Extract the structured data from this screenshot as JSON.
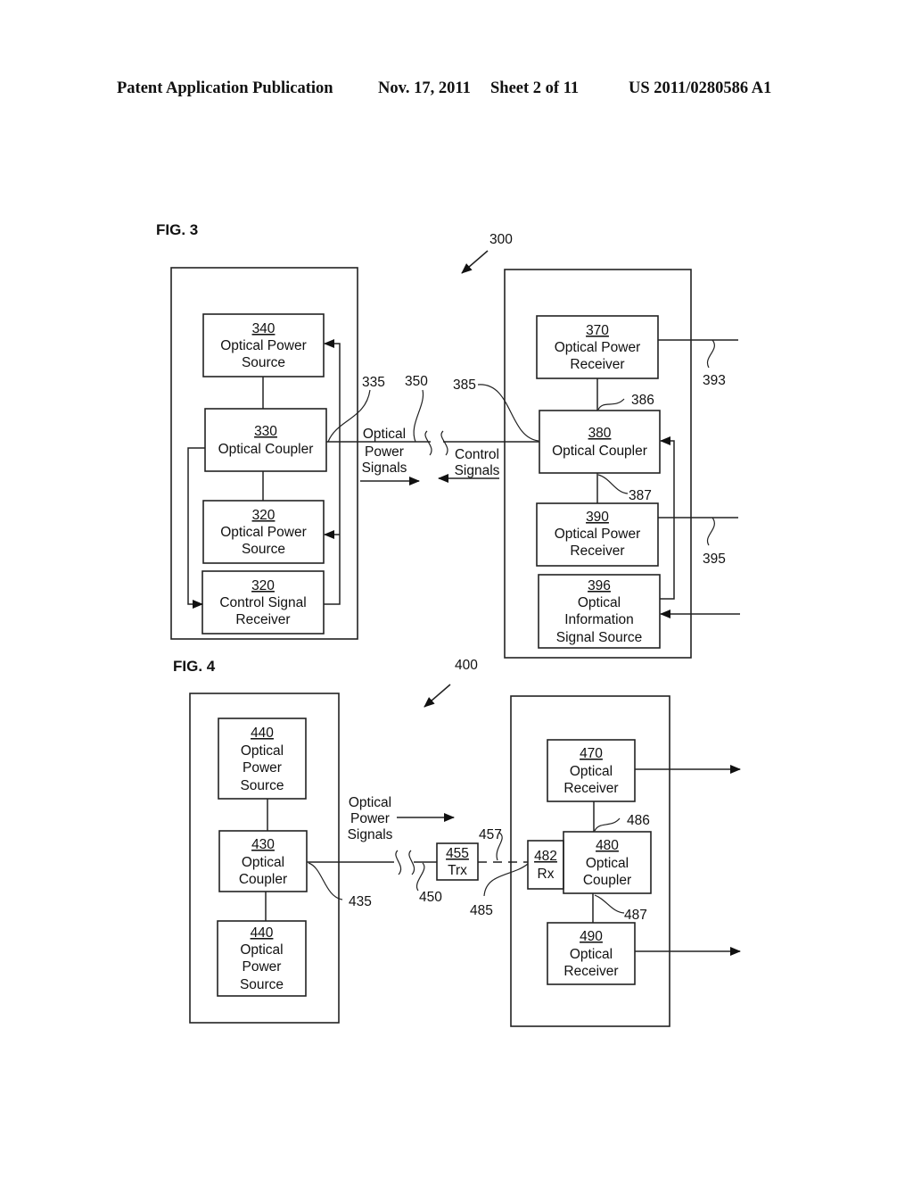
{
  "header": {
    "publication": "Patent Application Publication",
    "date": "Nov. 17, 2011",
    "sheet": "Sheet 2 of 11",
    "number": "US 2011/0280586 A1"
  },
  "fig3": {
    "title": "FIG. 3",
    "ref": "300",
    "blocks": {
      "b340": {
        "num": "340",
        "lines": [
          "Optical Power",
          "Source"
        ]
      },
      "b330": {
        "num": "330",
        "lines": [
          "Optical Coupler"
        ]
      },
      "b320a": {
        "num": "320",
        "lines": [
          "Optical Power",
          "Source"
        ]
      },
      "b320b": {
        "num": "320",
        "lines": [
          "Control Signal",
          "Receiver"
        ]
      },
      "b370": {
        "num": "370",
        "lines": [
          "Optical Power",
          "Receiver"
        ]
      },
      "b380": {
        "num": "380",
        "lines": [
          "Optical Coupler"
        ]
      },
      "b390": {
        "num": "390",
        "lines": [
          "Optical Power",
          "Receiver"
        ]
      },
      "b396": {
        "num": "396",
        "lines": [
          "Optical",
          "Information",
          "Signal Source"
        ]
      }
    },
    "refs": {
      "r335": "335",
      "r350": "350",
      "r385": "385",
      "r386": "386",
      "r387": "387",
      "r393": "393",
      "r395": "395"
    },
    "link_labels": {
      "power": [
        "Optical",
        "Power",
        "Signals"
      ],
      "control": [
        "Control",
        "Signals"
      ]
    }
  },
  "fig4": {
    "title": "FIG. 4",
    "ref": "400",
    "blocks": {
      "b440a": {
        "num": "440",
        "lines": [
          "Optical",
          "Power",
          "Source"
        ]
      },
      "b430": {
        "num": "430",
        "lines": [
          "Optical",
          "Coupler"
        ]
      },
      "b440b": {
        "num": "440",
        "lines": [
          "Optical",
          "Power",
          "Source"
        ]
      },
      "b455": {
        "num": "455",
        "lines": [
          "Trx"
        ]
      },
      "b482": {
        "num": "482",
        "lines": [
          "Rx"
        ]
      },
      "b470": {
        "num": "470",
        "lines": [
          "Optical",
          "Receiver"
        ]
      },
      "b480": {
        "num": "480",
        "lines": [
          "Optical",
          "Coupler"
        ]
      },
      "b490": {
        "num": "490",
        "lines": [
          "Optical",
          "Receiver"
        ]
      }
    },
    "refs": {
      "r435": "435",
      "r450": "450",
      "r457": "457",
      "r485": "485",
      "r486": "486",
      "r487": "487"
    },
    "link_labels": {
      "power": [
        "Optical",
        "Power",
        "Signals"
      ]
    }
  }
}
